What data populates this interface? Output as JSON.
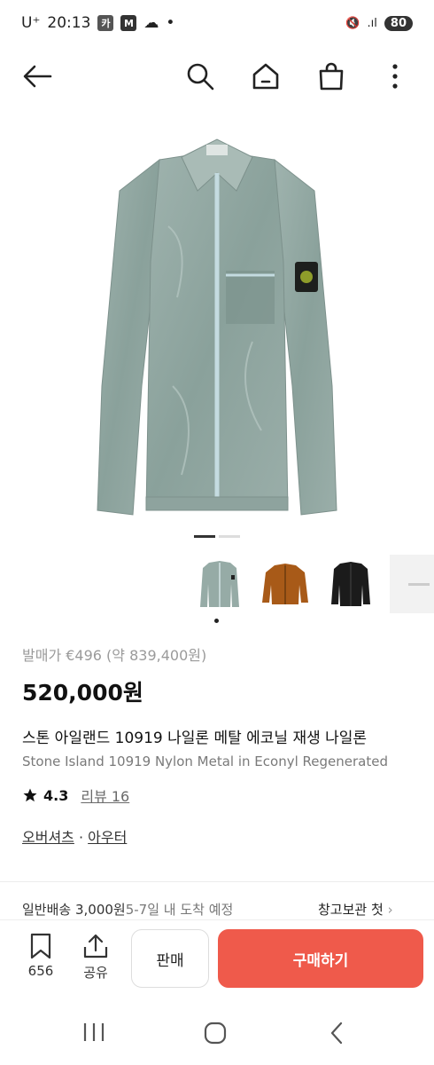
{
  "status_bar": {
    "carrier": "U⁺",
    "time": "20:13",
    "notif_badges": [
      "카",
      "M"
    ],
    "battery": "80"
  },
  "product": {
    "original_price": "발매가 €496 (약 839,400원)",
    "price": "520,000원",
    "title_ko": "스톤 아일랜드 10919 나일론 메탈 에코닐 재생 나일론",
    "title_en": "Stone Island 10919 Nylon Metal in Econyl Regenerated",
    "rating": "4.3",
    "review_label": "리뷰 16",
    "category_1": "오버셔츠",
    "category_sep": " · ",
    "category_2": "아우터"
  },
  "shipping": {
    "label": "일반배송 3,000원",
    "eta": " 5-7일 내 도착 예정",
    "warehouse": "창고보관 첫"
  },
  "bottom_bar": {
    "bookmark_count": "656",
    "share_label": "공유",
    "sell_label": "판매",
    "buy_label": "구매하기"
  },
  "colors": {
    "accent": "#ef5a4b",
    "jacket": "#8fa5a0"
  }
}
